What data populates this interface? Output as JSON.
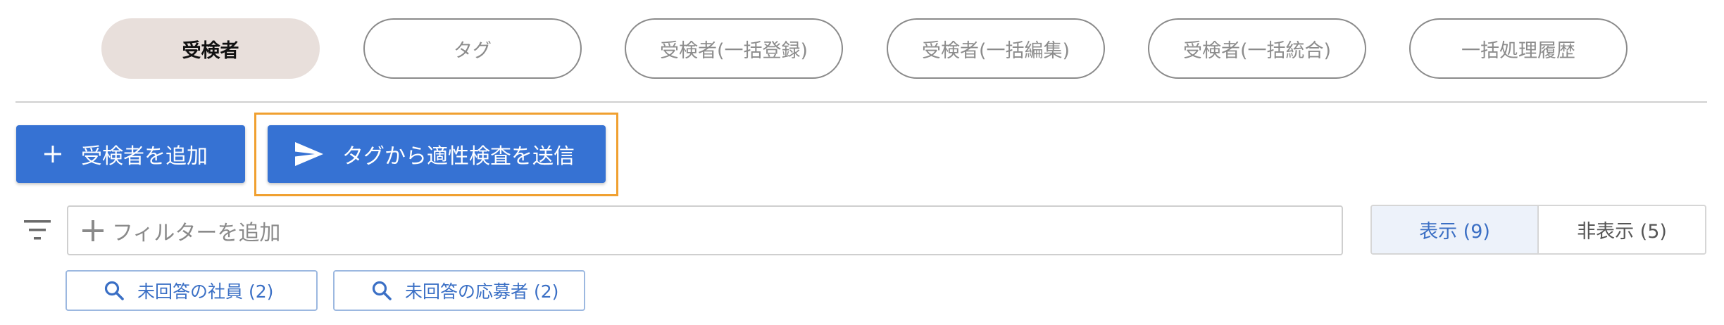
{
  "tabs": [
    {
      "label": "受検者",
      "active": true
    },
    {
      "label": "タグ",
      "active": false
    },
    {
      "label": "受検者(一括登録)",
      "active": false
    },
    {
      "label": "受検者(一括編集)",
      "active": false
    },
    {
      "label": "受検者(一括統合)",
      "active": false
    },
    {
      "label": "一括処理履歴",
      "active": false
    }
  ],
  "actions": {
    "add_label": "受検者を追加",
    "add_icon": "plus-icon",
    "send_label": "タグから適性検査を送信",
    "send_icon": "send-icon"
  },
  "filter": {
    "icon": "filter-icon",
    "placeholder": "フィルターを追加",
    "plus_icon": "plus-icon"
  },
  "visibility": {
    "shown_label": "表示 (9)",
    "hidden_label": "非表示 (5)",
    "selected": "shown"
  },
  "quick_filters": [
    {
      "label": "未回答の社員 (2)",
      "icon": "search-icon"
    },
    {
      "label": "未回答の応募者 (2)",
      "icon": "search-icon"
    }
  ],
  "colors": {
    "primary": "#3672d3",
    "active_tab_bg": "#e8dfdb",
    "highlight": "#f0a030",
    "chip_text": "#3a6fc5"
  }
}
